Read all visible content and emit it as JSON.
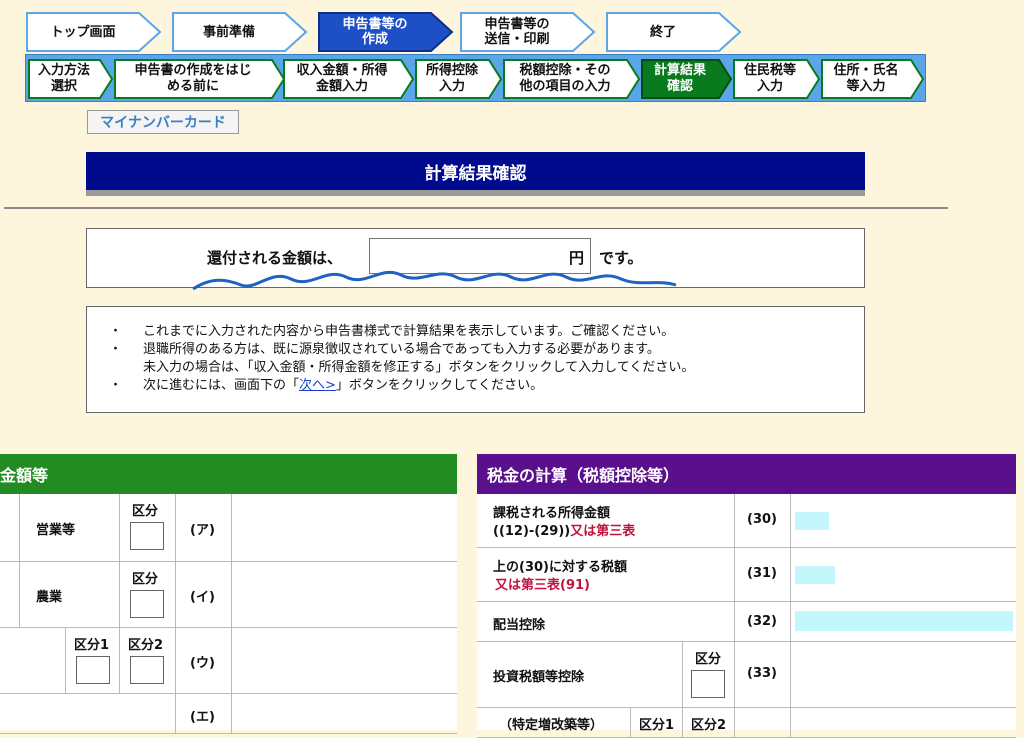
{
  "steps": [
    {
      "label": "トップ画面"
    },
    {
      "label": "事前準備"
    },
    {
      "label": "申告書等の\n作成"
    },
    {
      "label": "申告書等の\n送信・印刷"
    },
    {
      "label": "終了"
    }
  ],
  "substeps": [
    {
      "label": "入力方法\n選択"
    },
    {
      "label": "申告書の作成をはじ\nめる前に"
    },
    {
      "label": "収入金額・所得\n金額入力"
    },
    {
      "label": "所得控除\n入力"
    },
    {
      "label": "税額控除・その\n他の項目の入力"
    },
    {
      "label": "計算結果\n確認"
    },
    {
      "label": "住民税等\n入力"
    },
    {
      "label": "住所・氏名\n等入力"
    }
  ],
  "mynumber_button": "マイナンバーカード",
  "page_title": "計算結果確認",
  "refund": {
    "prefix": "還付される金額は、",
    "unit": "円",
    "suffix": "です。"
  },
  "notes": {
    "bullet": "・",
    "line1": "これまでに入力された内容から申告書様式で計算結果を表示しています。ご確認ください。",
    "line2": "退職所得のある方は、既に源泉徴収されている場合であっても入力する必要があります。",
    "line3": "未入力の場合は、「収入金額・所得金額を修正する」ボタンをクリックして入力してください。",
    "line4_pre": "次に進むには、画面下の「",
    "line4_link": "次へ>",
    "line4_post": "」ボタンをクリックしてください。"
  },
  "left_panel": {
    "header": "金額等",
    "kubun": "区分",
    "kubun1": "区分1",
    "kubun2": "区分2",
    "rows": [
      {
        "label": "営業等",
        "code": "(ア)"
      },
      {
        "label": "農業",
        "code": "(イ)"
      },
      {
        "label": "",
        "code": "(ウ)"
      },
      {
        "label": "",
        "code": "(エ)"
      }
    ]
  },
  "right_panel": {
    "header": "税金の計算（税額控除等）",
    "kubun": "区分",
    "kubun1": "区分1",
    "kubun2": "区分2",
    "rows": [
      {
        "line1": "課税される所得金額",
        "line2a": "((12)-(29))",
        "line2b": "又は第三表",
        "code": "(30)"
      },
      {
        "line1": "上の(30)に対する税額",
        "line2b": "又は第三表(91)",
        "code": "(31)"
      },
      {
        "line1": "配当控除",
        "code": "(32)"
      },
      {
        "line1": "投資税額等控除",
        "code": "(33)"
      },
      {
        "line1": "（特定増改築等）"
      }
    ]
  },
  "colors": {
    "active_step": "#1d4fc7",
    "title_bar": "#000a8c",
    "left_header": "#228b22",
    "right_header": "#5a0f8c",
    "active_sub": "#0a7a1e"
  }
}
